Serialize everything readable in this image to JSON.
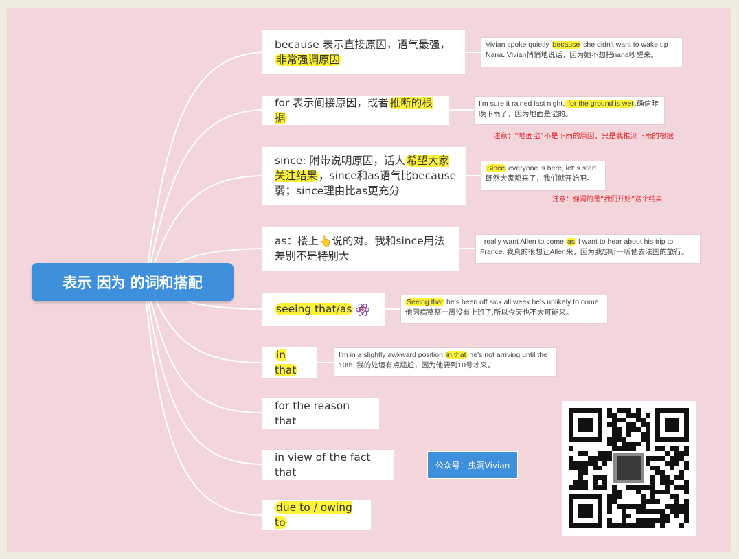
{
  "root": {
    "label": "表示 因为 的词和搭配"
  },
  "nodes": [
    {
      "id": "because",
      "parts": [
        {
          "t": "because 表示直接原因，语气最强，"
        },
        {
          "t": "非常强调原因",
          "hl": true
        }
      ]
    },
    {
      "id": "for",
      "parts": [
        {
          "t": "for 表示间接原因，或者"
        },
        {
          "t": "推断的根据",
          "hl": true
        }
      ]
    },
    {
      "id": "since",
      "parts": [
        {
          "t": "since: 附带说明原因，话人"
        },
        {
          "t": "希望大家关注结果",
          "hl": true
        },
        {
          "t": "，since和as语气比because弱；since理由比as更充分"
        }
      ]
    },
    {
      "id": "as",
      "parts": [
        {
          "t": "as：楼上👆说的对。我和since用法差别不是特别大"
        }
      ]
    },
    {
      "id": "seeing",
      "parts": [
        {
          "t": "seeing that/as",
          "hl": true
        }
      ]
    },
    {
      "id": "inthat",
      "parts": [
        {
          "t": "in that",
          "hl": true
        }
      ]
    },
    {
      "id": "reason",
      "parts": [
        {
          "t": "for the reason that"
        }
      ]
    },
    {
      "id": "view",
      "parts": [
        {
          "t": "in view of the fact that"
        }
      ]
    },
    {
      "id": "due",
      "parts": [
        {
          "t": "due to / owing to",
          "hl": true
        }
      ]
    }
  ],
  "examples": {
    "because": [
      {
        "t": "Vivian spoke quietly "
      },
      {
        "t": "because",
        "hl": true
      },
      {
        "t": " she didn't want to wake up Nana. Vivian悄悄地说话，因为她不想把nana吵醒来。"
      }
    ],
    "for": [
      {
        "t": "I'm sure it rained last night,"
      },
      {
        "t": " for the ground is wet",
        "hl": true
      },
      {
        "t": ".确信昨晚下雨了，因为地面是湿的。"
      }
    ],
    "since": [
      {
        "t": "Since",
        "hl": true
      },
      {
        "t": " everyone is here, let' s start. 既然大家都来了，我们就开始吧。"
      }
    ],
    "as": [
      {
        "t": "I really want Allen to come "
      },
      {
        "t": "as",
        "hl": true
      },
      {
        "t": " I want to hear about his trip to France.  我真的很想让Allen来，因为我想听一听他去法国的旅行。"
      }
    ],
    "seeing": [
      {
        "t": "Seeing that",
        "hl": true
      },
      {
        "t": " he's been off sick all week he's unlikely to come. 他因病整整一周没有上班了,所以今天也不大可能来。"
      }
    ],
    "inthat": [
      {
        "t": "    I'm in a slightly awkward position "
      },
      {
        "t": "in that",
        "hl": true
      },
      {
        "t": " he's not arriving until the 10th. 我的处境有点尴尬，因为他要到10号才来。"
      }
    ]
  },
  "notes": {
    "for": "注意：“地面湿”不是下雨的原因，只是我推测下雨的根据",
    "since": "注意：强调的是“我们开始”这个结果"
  },
  "wechat": {
    "label": "公众号：虫洞Vivian"
  },
  "colors": {
    "root": "#3e8fdc",
    "highlight": "#fdf23a",
    "note": "#e0262a",
    "canvas": "#f2d6dc"
  }
}
